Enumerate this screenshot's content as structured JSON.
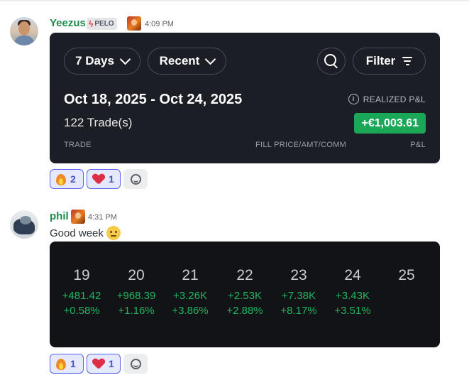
{
  "messages": [
    {
      "username": "Yeezus",
      "tag": "PELO",
      "time": "4:09 PM"
    },
    {
      "username": "phil",
      "time": "4:31 PM",
      "text": "Good week"
    }
  ],
  "trades_card": {
    "days_dropdown": "7 Days",
    "sort_dropdown": "Recent",
    "filter_label": "Filter",
    "date_range": "Oct 18, 2025 - Oct 24, 2025",
    "trade_count": "122 Trade(s)",
    "realized_label": "REALIZED P&L",
    "realized_value": "+€1,003.61",
    "columns": [
      "TRADE",
      "FILL PRICE/AMT/COMM",
      "P&L"
    ]
  },
  "reactions": [
    [
      {
        "icon": "fire-icon",
        "count": "2"
      },
      {
        "icon": "heart-icon",
        "count": "1"
      }
    ],
    [
      {
        "icon": "fire-icon",
        "count": "1"
      },
      {
        "icon": "heart-icon",
        "count": "1"
      }
    ]
  ],
  "calendar": [
    {
      "day": "19",
      "amount": "+481.42",
      "pct": "+0.58%"
    },
    {
      "day": "20",
      "amount": "+968.39",
      "pct": "+1.16%"
    },
    {
      "day": "21",
      "amount": "+3.26K",
      "pct": "+3.86%"
    },
    {
      "day": "22",
      "amount": "+2.53K",
      "pct": "+2.88%"
    },
    {
      "day": "23",
      "amount": "+7.38K",
      "pct": "+8.17%"
    },
    {
      "day": "24",
      "amount": "+3.43K",
      "pct": "+3.51%"
    },
    {
      "day": "25",
      "amount": "",
      "pct": ""
    }
  ],
  "colors": {
    "username": "#1f8b4c",
    "gain": "#21b462",
    "badge": "#1aa858",
    "reaction_border": "#5865f2"
  }
}
